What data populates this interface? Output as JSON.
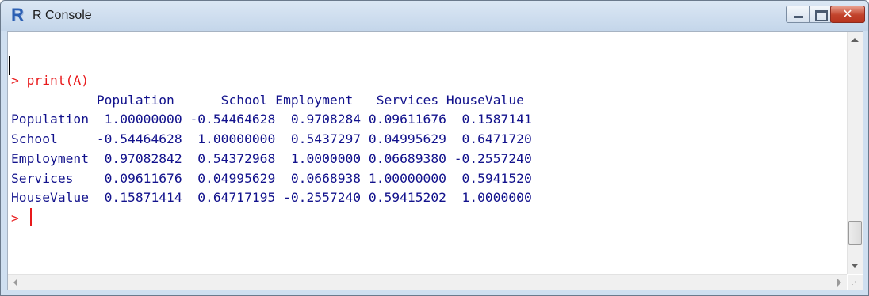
{
  "window": {
    "title": "R Console",
    "buttons": {
      "minimize": "",
      "maximize": "",
      "close": "✕"
    }
  },
  "console": {
    "prompt": "> ",
    "command": "print(A)",
    "output_lines": [
      "           Population      School Employment   Services HouseValue",
      "Population  1.00000000 -0.54464628  0.9708284 0.09611676  0.1587141",
      "School     -0.54464628  1.00000000  0.5437297 0.04995629  0.6471720",
      "Employment  0.97082842  0.54372968  1.0000000 0.06689380 -0.2557240",
      "Services    0.09611676  0.04995629  0.0668938 1.00000000  0.5941520",
      "HouseValue  0.15871414  0.64717195 -0.2557240 0.59415202  1.0000000"
    ],
    "current_prompt": "> ",
    "matrix": {
      "columns": [
        "Population",
        "School",
        "Employment",
        "Services",
        "HouseValue"
      ],
      "rows": [
        {
          "name": "Population",
          "values": [
            "1.00000000",
            "-0.54464628",
            "0.9708284",
            "0.09611676",
            "0.1587141"
          ]
        },
        {
          "name": "School",
          "values": [
            "-0.54464628",
            "1.00000000",
            "0.5437297",
            "0.04995629",
            "0.6471720"
          ]
        },
        {
          "name": "Employment",
          "values": [
            "0.97082842",
            "0.54372968",
            "1.0000000",
            "0.06689380",
            "-0.2557240"
          ]
        },
        {
          "name": "Services",
          "values": [
            "0.09611676",
            "0.04995629",
            "0.0668938",
            "1.00000000",
            "0.5941520"
          ]
        },
        {
          "name": "HouseValue",
          "values": [
            "0.15871414",
            "0.64717195",
            "-0.2557240",
            "0.59415202",
            "1.0000000"
          ]
        }
      ]
    }
  },
  "colors": {
    "command": "#e8191b",
    "output": "#12128c",
    "title_bar": "#dbe7f4"
  },
  "icons": {
    "app": "r-logo-icon"
  }
}
